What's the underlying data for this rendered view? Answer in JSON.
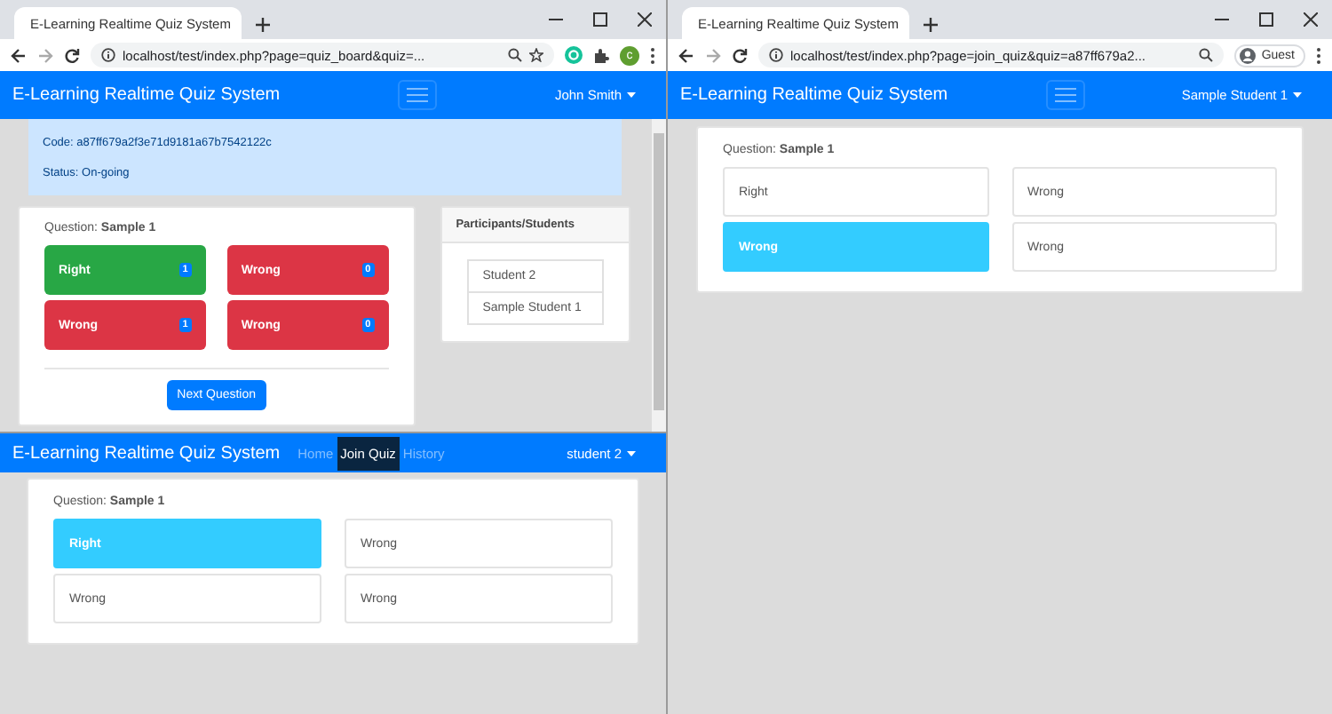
{
  "windows": [
    {
      "kind": "teacher",
      "browser": {
        "tab_title": "E-Learning Realtime Quiz System",
        "url": "localhost/test/index.php?page=quiz_board&quiz=...",
        "profile_initial": "c"
      },
      "navbar": {
        "brand": "E-Learning Realtime Quiz System",
        "user": "John Smith"
      },
      "info": {
        "code": "Code: a87ff679a2f3e71d9181a67b7542122c",
        "status": "Status: On-going"
      },
      "question": {
        "label": "Question:",
        "title": "Sample 1"
      },
      "answers": [
        {
          "text": "Right",
          "count": "1",
          "correct": true
        },
        {
          "text": "Wrong",
          "count": "0",
          "correct": false
        },
        {
          "text": "Wrong",
          "count": "1",
          "correct": false
        },
        {
          "text": "Wrong",
          "count": "0",
          "correct": false
        }
      ],
      "next_button": "Next Question",
      "participants": {
        "title": "Participants/Students",
        "items": [
          "Student 2",
          "Sample Student 1"
        ]
      }
    },
    {
      "kind": "student",
      "browser": {
        "tab_title": "E-Learning Realtime Quiz System",
        "url": "localhost/test/index.php?page=join_quiz&quiz=a87ff679a2...",
        "profile_label": "Guest"
      },
      "navbar": {
        "brand": "E-Learning Realtime Quiz System",
        "user": "Sample Student 1"
      },
      "question": {
        "label": "Question:",
        "title": "Sample 1"
      },
      "answers": [
        {
          "text": "Right",
          "selected": false
        },
        {
          "text": "Wrong",
          "selected": false
        },
        {
          "text": "Wrong",
          "selected": true
        },
        {
          "text": "Wrong",
          "selected": false
        }
      ]
    },
    {
      "kind": "student",
      "navbar": {
        "brand": "E-Learning Realtime Quiz System",
        "links": [
          {
            "label": "Home",
            "selected": false
          },
          {
            "label": "Join Quiz",
            "selected": true
          },
          {
            "label": "History",
            "selected": false
          }
        ],
        "user": "student 2"
      },
      "question": {
        "label": "Question:",
        "title": "Sample 1"
      },
      "answers": [
        {
          "text": "Right",
          "selected": true
        },
        {
          "text": "Wrong",
          "selected": false
        },
        {
          "text": "Wrong",
          "selected": false
        },
        {
          "text": "Wrong",
          "selected": false
        }
      ]
    }
  ]
}
